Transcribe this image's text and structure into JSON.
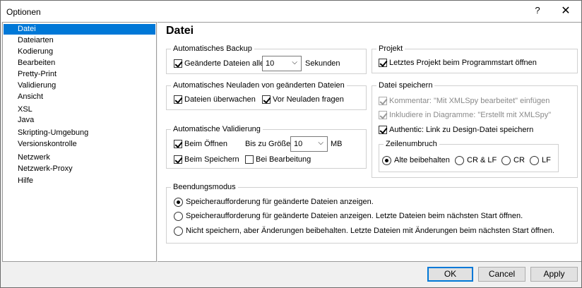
{
  "window": {
    "title": "Optionen",
    "help": "?",
    "close": "✕"
  },
  "sidebar": {
    "items": [
      {
        "label": "Datei",
        "selected": true
      },
      {
        "label": "Dateiarten"
      },
      {
        "label": "Kodierung"
      },
      {
        "label": "Bearbeiten"
      },
      {
        "label": "Pretty-Print"
      },
      {
        "label": "Validierung"
      },
      {
        "label": "Ansicht"
      },
      {
        "label": "XSL"
      },
      {
        "label": "Java"
      },
      {
        "label": "Skripting-Umgebung"
      },
      {
        "label": "Versionskontrolle"
      },
      {
        "label": "Netzwerk"
      },
      {
        "label": "Netzwerk-Proxy"
      },
      {
        "label": "Hilfe"
      }
    ]
  },
  "page_title": "Datei",
  "backup": {
    "legend": "Automatisches Backup",
    "label": "Geänderte Dateien alle",
    "value": "10",
    "unit": "Sekunden",
    "checked": true
  },
  "reload": {
    "legend": "Automatisches Neuladen von geänderten Dateien",
    "watch": "Dateien überwachen",
    "ask": "Vor Neuladen fragen"
  },
  "validation": {
    "legend": "Automatische Validierung",
    "on_open": "Beim Öffnen",
    "size_label": "Bis zu Größe",
    "size_value": "10",
    "size_unit": "MB",
    "on_save": "Beim Speichern",
    "on_edit": "Bei Bearbeitung"
  },
  "project": {
    "legend": "Projekt",
    "open_last": "Letztes Projekt beim Programmstart öffnen"
  },
  "save": {
    "legend": "Datei speichern",
    "comment": "Kommentar: \"Mit XMLSpy bearbeitet\" einfügen",
    "diagrams": "Inkludiere in Diagramme: \"Erstellt mit XMLSpy\"",
    "authentic": "Authentic: Link zu Design-Datei speichern",
    "linebreak": {
      "legend": "Zeilenumbruch",
      "options": [
        "Alte beibehalten",
        "CR & LF",
        "CR",
        "LF"
      ]
    }
  },
  "exit": {
    "legend": "Beendungsmodus",
    "options": [
      "Speicheraufforderung für geänderte Dateien anzeigen.",
      "Speicheraufforderung für geänderte Dateien anzeigen. Letzte Dateien beim nächsten Start öffnen.",
      "Nicht speichern, aber Änderungen beibehalten. Letzte Dateien mit Änderungen beim nächsten Start öffnen."
    ]
  },
  "buttons": {
    "ok": "OK",
    "cancel": "Cancel",
    "apply": "Apply"
  },
  "colors": {
    "selection": "#0078d7",
    "window_bg": "#f0f0f0"
  },
  "icons": {
    "dropdown": "chevron-down-icon",
    "close": "close-icon"
  }
}
